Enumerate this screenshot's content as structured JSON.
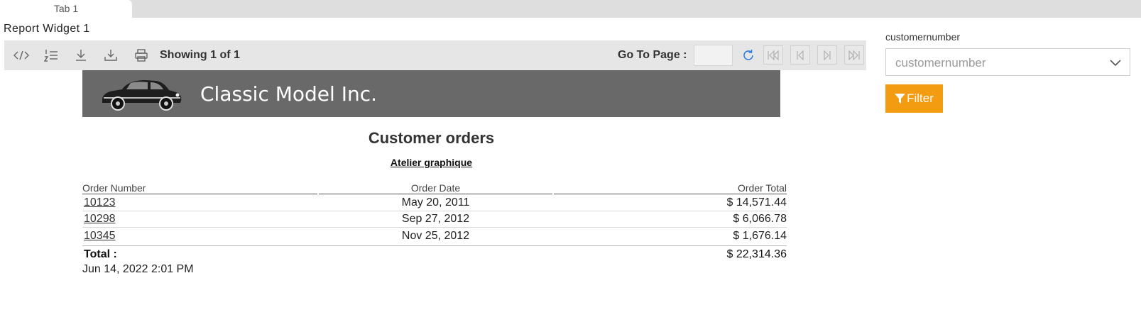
{
  "tab": {
    "label": "Tab 1"
  },
  "widget": {
    "title": "Report Widget 1"
  },
  "toolbar": {
    "icons": [
      "code-icon",
      "numbered-list-icon",
      "download-icon",
      "download-alt-icon",
      "print-icon"
    ],
    "showing": "Showing 1 of 1",
    "goto_label": "Go To Page :",
    "goto_value": "",
    "pager_icons": [
      "first-page-icon",
      "previous-page-icon",
      "next-page-icon",
      "last-page-icon"
    ]
  },
  "report": {
    "company": "Classic Model Inc.",
    "title": "Customer orders",
    "customer": "Atelier graphique",
    "columns": {
      "order_number": "Order Number",
      "order_date": "Order Date",
      "order_total": "Order Total"
    },
    "rows": [
      {
        "number": "10123",
        "date": "May 20, 2011",
        "total": "$ 14,571.44"
      },
      {
        "number": "10298",
        "date": "Sep 27, 2012",
        "total": "$ 6,066.78"
      },
      {
        "number": "10345",
        "date": "Nov 25, 2012",
        "total": "$ 1,676.14"
      }
    ],
    "total_label": "Total :",
    "total_value": "$ 22,314.36",
    "timestamp": "Jun 14, 2022 2:01 PM"
  },
  "filter": {
    "label": "customernumber",
    "placeholder": "customernumber",
    "button": "Filter",
    "button_color": "#f39c12"
  },
  "colors": {
    "banner": "#696969",
    "toolbar": "#e6e6e6",
    "tabbar": "#dedede",
    "accent": "#2f7de1"
  }
}
